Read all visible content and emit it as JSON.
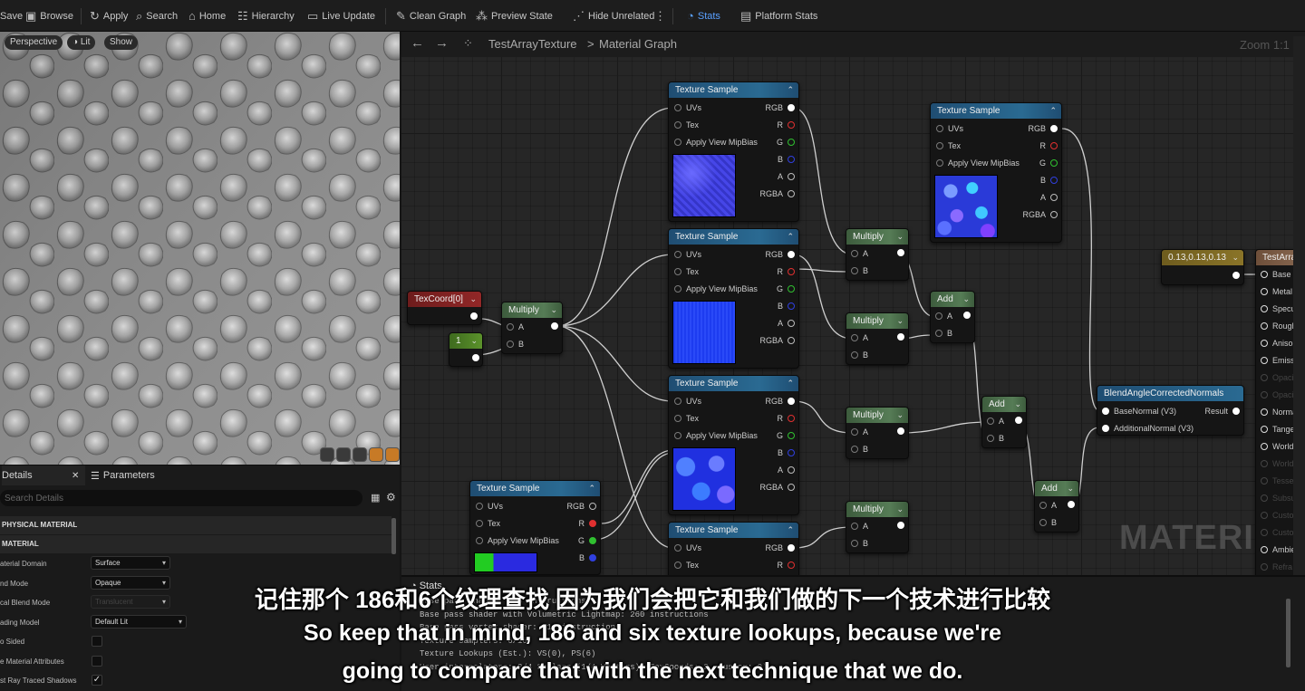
{
  "toolbar": {
    "save": "Save",
    "browse": "Browse",
    "apply": "Apply",
    "search": "Search",
    "home": "Home",
    "hierarchy": "Hierarchy",
    "live_update": "Live Update",
    "clean_graph": "Clean Graph",
    "preview_state": "Preview State",
    "hide_unrelated": "Hide Unrelated",
    "stats": "Stats",
    "platform_stats": "Platform Stats"
  },
  "viewport": {
    "perspective": "Perspective",
    "lit": "Lit",
    "show": "Show"
  },
  "details": {
    "tab_details": "Details",
    "tab_parameters": "Parameters",
    "search_placeholder": "Search Details",
    "sections": [
      "PHYSICAL MATERIAL",
      "MATERIAL"
    ],
    "rows": [
      {
        "label": "aterial Domain",
        "value": "Surface"
      },
      {
        "label": "nd Mode",
        "value": "Opaque"
      },
      {
        "label": "cal Blend Mode",
        "value": "Translucent"
      },
      {
        "label": "ading Model",
        "value": "Default Lit"
      },
      {
        "label": "o Sided",
        "value": ""
      },
      {
        "label": "e Material Attributes",
        "value": ""
      },
      {
        "label": "st Ray Traced Shadows",
        "value": "✓"
      }
    ]
  },
  "graph": {
    "breadcrumb_asset": "TestArrayTexture",
    "breadcrumb_sep": ">",
    "breadcrumb_graph": "Material Graph",
    "zoom": "Zoom 1:1",
    "watermark": "MATERIAL",
    "pins": {
      "uvs": "UVs",
      "tex": "Tex",
      "mip": "Apply View MipBias",
      "rgb": "RGB",
      "r": "R",
      "g": "G",
      "b": "B",
      "a": "A",
      "rgba": "RGBA",
      "a_in": "A",
      "b_in": "B",
      "base_normal": "BaseNormal (V3)",
      "additional_normal": "AdditionalNormal (V3)",
      "result": "Result"
    },
    "nodes": {
      "texture_sample": "Texture Sample",
      "multiply": "Multiply",
      "add": "Add",
      "texcoord": "TexCoord[0]",
      "constant": "1",
      "vector": "0.13,0.13,0.13",
      "blend": "BlendAngleCorrectedNormals",
      "result": "TestArra"
    },
    "result_pins": [
      "Base",
      "Metal",
      "Specu",
      "Rough",
      "Aniso",
      "Emiss",
      "Opaci",
      "Opaci",
      "Norma",
      "Tange",
      "World",
      "World",
      "Tesse",
      "Subsu",
      "Custo",
      "Custo",
      "Ambie",
      "Refra"
    ]
  },
  "stats": {
    "tab": "Stats",
    "lines": [
      "Base pass shader: 186 instructions",
      "Base pass shader with Volumetric Lightmap: 260 instructions",
      "Base pass vertex shader: 114 instructions",
      "Texture samplers: 6/16",
      "Texture Lookups (Est.): VS(0), PS(6)",
      "User interpolators: 2/4 Scalars (1/4 Vectors) (TexCoords: 2, Custom: 0)"
    ]
  },
  "subtitles": {
    "zh": "记住那个 186和6个纹理查找 因为我们会把它和我们做的下一个技术进行比较",
    "en1": "So keep that in mind, 186 and six texture lookups, because we're",
    "en2": "going to compare that with the next technique that we do."
  }
}
